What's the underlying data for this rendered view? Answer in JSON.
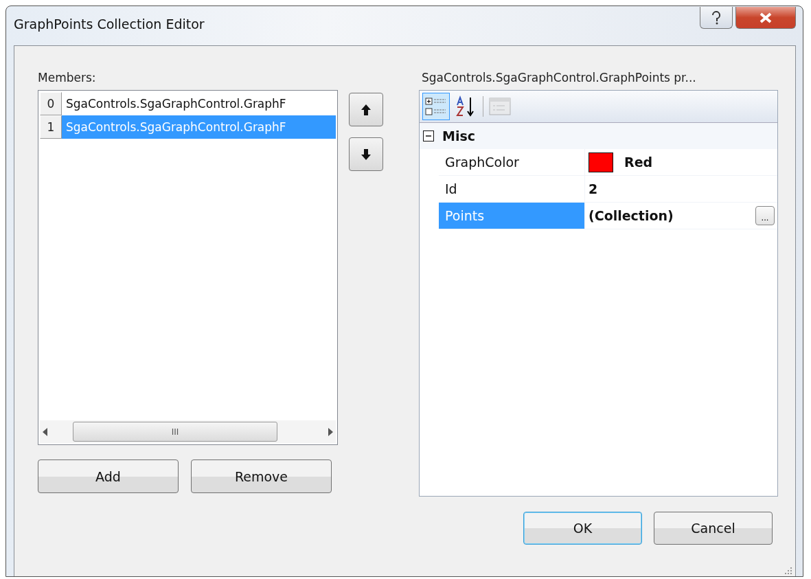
{
  "window": {
    "title": "GraphPoints Collection Editor"
  },
  "members_label": "Members:",
  "members": [
    {
      "index": "0",
      "label": "SgaControls.SgaGraphControl.GraphF",
      "selected": false
    },
    {
      "index": "1",
      "label": "SgaControls.SgaGraphControl.GraphF",
      "selected": true
    }
  ],
  "scrollbar_grip": "III",
  "list_buttons": [
    "Add",
    "Remove"
  ],
  "properties_label": "SgaControls.SgaGraphControl.GraphPoints pr...",
  "toolbar": [
    {
      "kind": "categorized",
      "selected": true
    },
    {
      "kind": "alphabetical",
      "selected": false
    },
    {
      "kind": "pages",
      "selected": false,
      "disabled": true
    }
  ],
  "categories": [
    {
      "name": "Misc",
      "expanded": true,
      "properties": [
        {
          "name": "GraphColor",
          "value": "Red",
          "kind": "color",
          "color": "#ff0000",
          "selected": false
        },
        {
          "name": "Id",
          "value": "2",
          "kind": "text",
          "selected": false
        },
        {
          "name": "Points",
          "value": "(Collection)",
          "kind": "collection",
          "button": "...",
          "selected": true
        }
      ]
    }
  ],
  "buttons": [
    {
      "label": "OK",
      "default": true
    },
    {
      "label": "Cancel",
      "default": false
    }
  ]
}
